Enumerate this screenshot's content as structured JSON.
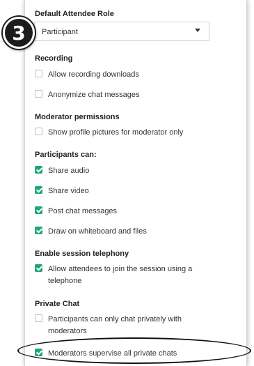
{
  "step_badge": "3",
  "default_role": {
    "heading": "Default Attendee Role",
    "selected": "Participant"
  },
  "recording": {
    "heading": "Recording",
    "options": [
      {
        "label": "Allow recording downloads",
        "checked": false
      },
      {
        "label": "Anonymize chat messages",
        "checked": false
      }
    ]
  },
  "moderator_permissions": {
    "heading": "Moderator permissions",
    "options": [
      {
        "label": "Show profile pictures for moderator only",
        "checked": false
      }
    ]
  },
  "participants_can": {
    "heading": "Participants can:",
    "options": [
      {
        "label": "Share audio",
        "checked": true
      },
      {
        "label": "Share video",
        "checked": true
      },
      {
        "label": "Post chat messages",
        "checked": true
      },
      {
        "label": "Draw on whiteboard and files",
        "checked": true
      }
    ]
  },
  "telephony": {
    "heading": "Enable session telephony",
    "options": [
      {
        "label": "Allow attendees to join the session using a telephone",
        "checked": true
      }
    ]
  },
  "private_chat": {
    "heading": "Private Chat",
    "options": [
      {
        "label": "Participants can only chat privately with moderators",
        "checked": false
      },
      {
        "label": "Moderators supervise all private chats",
        "checked": true
      }
    ]
  },
  "colors": {
    "checkbox_checked": "#1ea774",
    "annotation": "#111111"
  }
}
